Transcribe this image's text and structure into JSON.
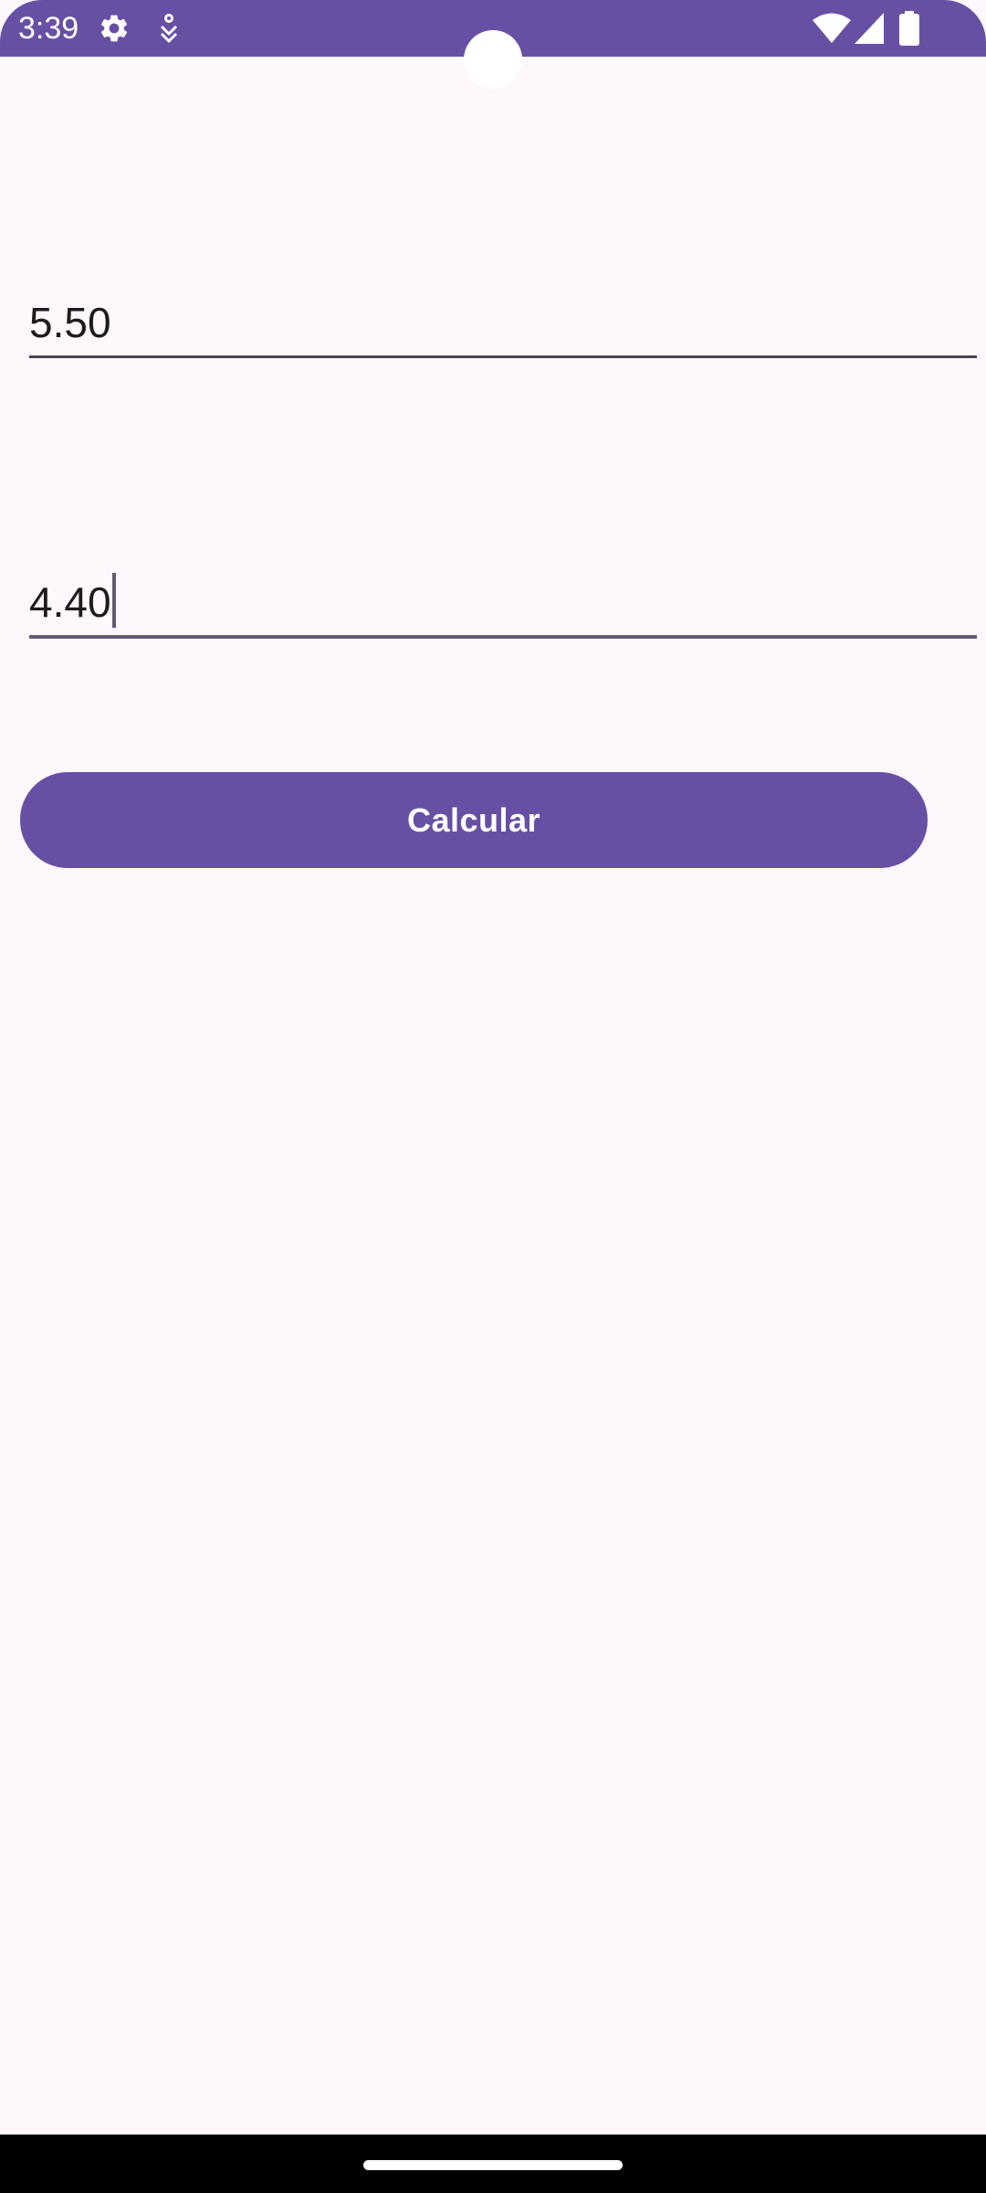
{
  "status_bar": {
    "time": "3:39",
    "background_color": "#6750a4",
    "left_icons": [
      "gear-icon",
      "accessibility-icon"
    ],
    "right_icons": [
      "wifi-icon",
      "cellular-signal-icon",
      "battery-icon"
    ]
  },
  "form": {
    "first_input": {
      "value": "5.50"
    },
    "second_input": {
      "value": "4.40",
      "focused": true
    },
    "calculate_button": {
      "label": "Calcular",
      "color": "#6750a4"
    }
  },
  "theme": {
    "background": "#fef7fc",
    "primary": "#6750a4",
    "text": "#1d1b20"
  }
}
